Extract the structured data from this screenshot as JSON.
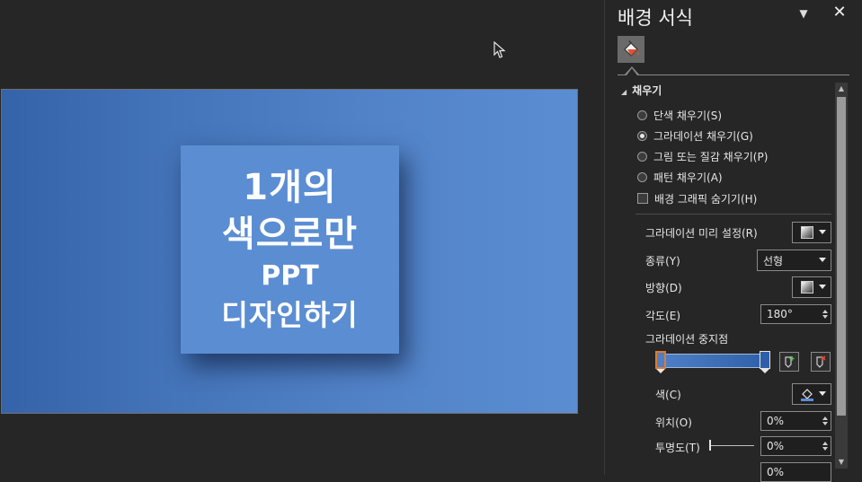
{
  "slide": {
    "title_lines": [
      "1개의",
      "색으로만",
      "PPT",
      "디자인하기"
    ]
  },
  "pane": {
    "title": "배경 서식",
    "options_icon": "chevron-down-icon",
    "close_icon": "close-icon",
    "tab_icon": "paint-bucket-icon",
    "section_title": "채우기",
    "fill_options": [
      {
        "label": "단색 채우기(S)",
        "selected": false
      },
      {
        "label": "그라데이션 채우기(G)",
        "selected": true
      },
      {
        "label": "그림 또는 질감 채우기(P)",
        "selected": false
      },
      {
        "label": "패턴 채우기(A)",
        "selected": false
      }
    ],
    "hide_graphics_label": "배경 그래픽 숨기기(H)",
    "preset_label": "그라데이션 미리 설정(R)",
    "type_label": "종류(Y)",
    "type_value": "선형",
    "direction_label": "방향(D)",
    "angle_label": "각도(E)",
    "angle_value": "180°",
    "stops_label": "그라데이션 중지점",
    "add_stop_icon": "add-gradient-stop-icon",
    "remove_stop_icon": "remove-gradient-stop-icon",
    "color_label": "색(C)",
    "position_label": "위치(O)",
    "position_value": "0%",
    "transparency_label": "투명도(T)",
    "transparency_value": "0%",
    "brightness_value": "0%",
    "accent_color": "#5b8dd3",
    "stop_selected_color": "#e07b2c"
  }
}
